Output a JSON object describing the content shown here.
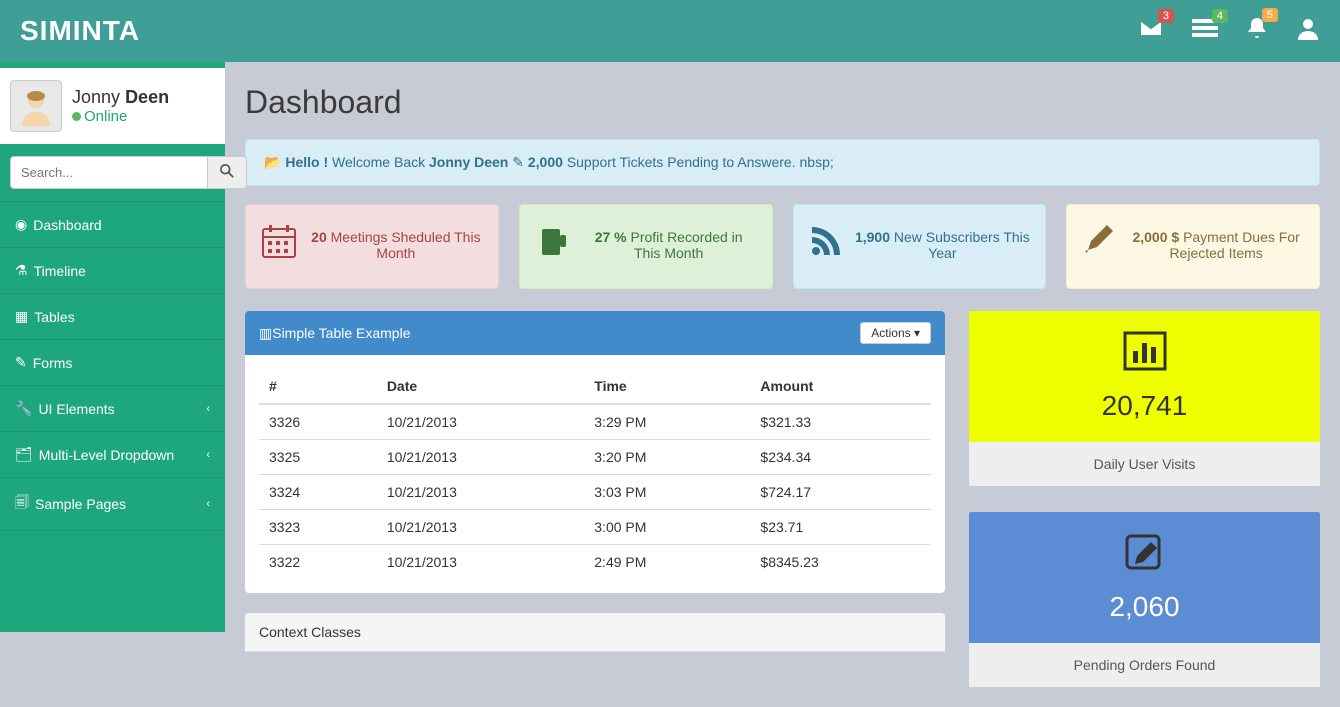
{
  "brand": "SIMINTA",
  "notifications": {
    "mail": "3",
    "tasks": "4",
    "bell": "5"
  },
  "user": {
    "first": "Jonny",
    "last": "Deen",
    "status": "Online"
  },
  "search": {
    "placeholder": "Search..."
  },
  "menu": {
    "dashboard": "Dashboard",
    "timeline": "Timeline",
    "tables": "Tables",
    "forms": "Forms",
    "ui": "UI Elements",
    "multi": "Multi-Level Dropdown",
    "sample": "Sample Pages"
  },
  "page_title": "Dashboard",
  "alert": {
    "hello": "Hello !",
    "welcome_back": "Welcome Back",
    "name": "Jonny Deen",
    "tickets": "2,000",
    "tickets_suffix": "Support Tickets Pending to Answere. nbsp;"
  },
  "stats": {
    "meetings": {
      "value": "20",
      "label": "Meetings Sheduled This Month"
    },
    "profit": {
      "value": "27 %",
      "label": "Profit Recorded in This Month"
    },
    "subs": {
      "value": "1,900",
      "label": "New Subscribers This Year"
    },
    "dues": {
      "value": "2,000 $",
      "label": "Payment Dues For Rejected Items"
    }
  },
  "table_panel": {
    "title": "Simple Table Example",
    "actions": "Actions",
    "headers": {
      "num": "#",
      "date": "Date",
      "time": "Time",
      "amount": "Amount"
    },
    "rows": [
      {
        "num": "3326",
        "date": "10/21/2013",
        "time": "3:29 PM",
        "amount": "$321.33"
      },
      {
        "num": "3325",
        "date": "10/21/2013",
        "time": "3:20 PM",
        "amount": "$234.34"
      },
      {
        "num": "3324",
        "date": "10/21/2013",
        "time": "3:03 PM",
        "amount": "$724.17"
      },
      {
        "num": "3323",
        "date": "10/21/2013",
        "time": "3:00 PM",
        "amount": "$23.71"
      },
      {
        "num": "3322",
        "date": "10/21/2013",
        "time": "2:49 PM",
        "amount": "$8345.23"
      }
    ]
  },
  "metrics": {
    "visits": {
      "value": "20,741",
      "label": "Daily User Visits"
    },
    "orders": {
      "value": "2,060",
      "label": "Pending Orders Found"
    }
  },
  "context_panel": {
    "title": "Context Classes"
  }
}
